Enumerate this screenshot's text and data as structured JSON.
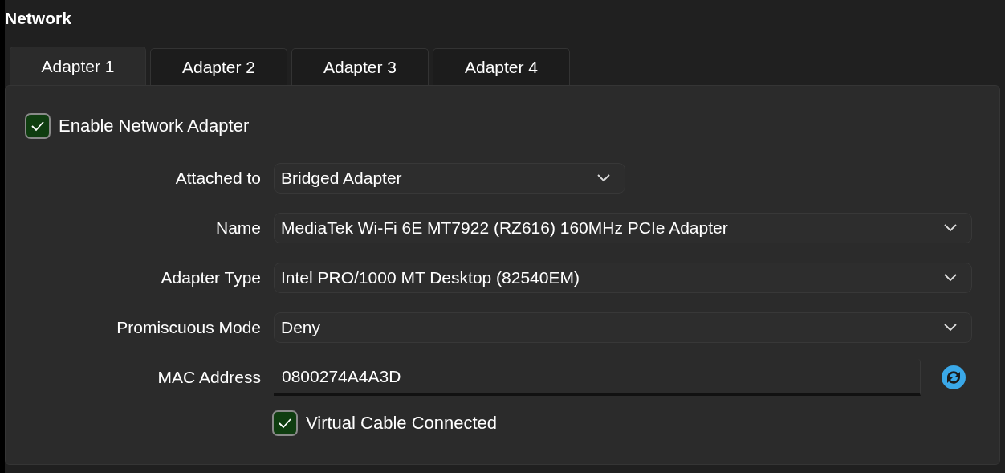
{
  "section": {
    "title": "Network"
  },
  "tabs": [
    {
      "label": "Adapter 1",
      "selected": true
    },
    {
      "label": "Adapter 2",
      "selected": false
    },
    {
      "label": "Adapter 3",
      "selected": false
    },
    {
      "label": "Adapter 4",
      "selected": false
    }
  ],
  "enable_adapter": {
    "label": "Enable Network Adapter",
    "checked": true
  },
  "fields": [
    {
      "kind": "dropdown",
      "label": "Attached to",
      "value": "Bridged Adapter",
      "short": true
    },
    {
      "kind": "dropdown",
      "label": "Name",
      "value": "MediaTek Wi-Fi 6E MT7922 (RZ616) 160MHz PCIe Adapter",
      "short": false
    },
    {
      "kind": "dropdown",
      "label": "Adapter Type",
      "value": "Intel PRO/1000 MT Desktop (82540EM)",
      "short": false
    },
    {
      "kind": "dropdown",
      "label": "Promiscuous Mode",
      "value": "Deny",
      "short": false
    },
    {
      "kind": "text",
      "label": "MAC Address",
      "value": "0800274A4A3D"
    }
  ],
  "cable_connected": {
    "label": "Virtual Cable Connected",
    "checked": true
  }
}
